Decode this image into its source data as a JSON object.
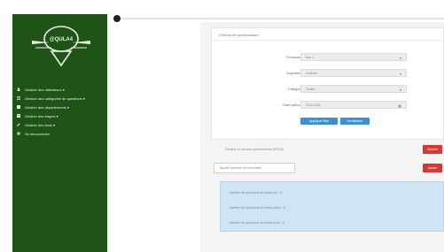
{
  "sidebar": {
    "logo_text": "@QULA4",
    "items": [
      {
        "icon": "user-icon",
        "label": "Gestion des utilisateurs ▾"
      },
      {
        "icon": "list-icon",
        "label": "Gestion des catégories de questions ▾"
      },
      {
        "icon": "building-icon",
        "label": "Gestion des départements ▾"
      },
      {
        "icon": "table-icon",
        "label": "Gestion des étapes ▾"
      },
      {
        "icon": "pencil-icon",
        "label": "Gestion des tests ▾"
      },
      {
        "icon": "gear-icon",
        "label": "Se déconnecter"
      }
    ]
  },
  "panel": {
    "title": "Critères de questionnaire",
    "fields": [
      {
        "label": "Processus",
        "value": "Bac 1"
      },
      {
        "label": "Exposition",
        "value": "Contrôle"
      },
      {
        "label": "Catégorie",
        "value": "Toutes"
      },
      {
        "label": "Date période",
        "value": "2020-2021"
      }
    ],
    "buttons": {
      "apply": "Appliquer filtre",
      "reset": "Réinitialiser"
    }
  },
  "rows": {
    "row1_text": "Générer le nouveau questionnaire (ROSE)",
    "row1_button": "Générer",
    "row2_text": "Ajouter question de formulaire",
    "row2_button": "Ajouter"
  },
  "info": {
    "lines": [
      "Nombre de questions de niveau un : 5",
      "Nombre de questions de niveau deux : 6",
      "Nombre de questions de niveau trois : 8"
    ]
  },
  "colors": {
    "sidebar": "#1f5417",
    "primary": "#3a8fd9",
    "danger": "#d9362f",
    "info": "#cfe5f6"
  }
}
